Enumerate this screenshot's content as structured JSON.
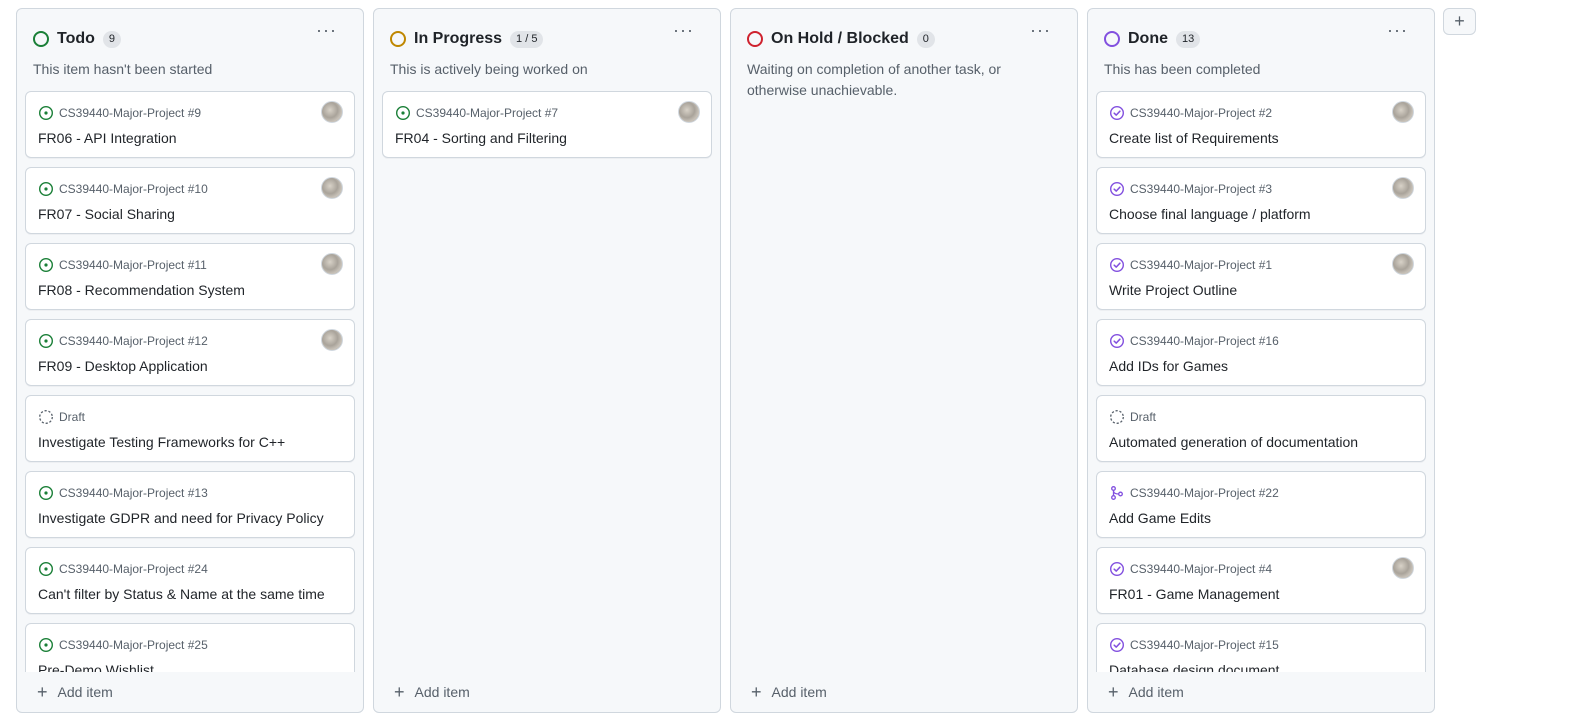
{
  "columns": [
    {
      "title": "Todo",
      "count": "9",
      "color": "#1a7f37",
      "description": "This item hasn't been started",
      "menu": "···",
      "add_label": "Add item",
      "cards": [
        {
          "kind": "open",
          "meta": "CS39440-Major-Project #9",
          "title": "FR06 - API Integration",
          "avatar": true
        },
        {
          "kind": "open",
          "meta": "CS39440-Major-Project #10",
          "title": "FR07 - Social Sharing",
          "avatar": true
        },
        {
          "kind": "open",
          "meta": "CS39440-Major-Project #11",
          "title": "FR08 - Recommendation System",
          "avatar": true
        },
        {
          "kind": "open",
          "meta": "CS39440-Major-Project #12",
          "title": "FR09 - Desktop Application",
          "avatar": true
        },
        {
          "kind": "draft",
          "meta": "Draft",
          "title": "Investigate Testing Frameworks for C++",
          "avatar": false
        },
        {
          "kind": "open",
          "meta": "CS39440-Major-Project #13",
          "title": "Investigate GDPR and need for Privacy Policy",
          "avatar": false
        },
        {
          "kind": "open",
          "meta": "CS39440-Major-Project #24",
          "title": "Can't filter by Status & Name at the same time",
          "avatar": false
        },
        {
          "kind": "open",
          "meta": "CS39440-Major-Project #25",
          "title": "Pre-Demo Wishlist",
          "avatar": false
        }
      ]
    },
    {
      "title": "In Progress",
      "count": "1 / 5",
      "color": "#bf8700",
      "description": "This is actively being worked on",
      "menu": "···",
      "add_label": "Add item",
      "cards": [
        {
          "kind": "open",
          "meta": "CS39440-Major-Project #7",
          "title": "FR04 - Sorting and Filtering",
          "avatar": true
        }
      ]
    },
    {
      "title": "On Hold / Blocked",
      "count": "0",
      "color": "#cf222e",
      "description": "Waiting on completion of another task, or otherwise unachievable.",
      "menu": "···",
      "add_label": "Add item",
      "cards": []
    },
    {
      "title": "Done",
      "count": "13",
      "color": "#8250df",
      "description": "This has been completed",
      "menu": "···",
      "add_label": "Add item",
      "cards": [
        {
          "kind": "done",
          "meta": "CS39440-Major-Project #2",
          "title": "Create list of Requirements",
          "avatar": true
        },
        {
          "kind": "done",
          "meta": "CS39440-Major-Project #3",
          "title": "Choose final language / platform",
          "avatar": true
        },
        {
          "kind": "done",
          "meta": "CS39440-Major-Project #1",
          "title": "Write Project Outline",
          "avatar": true
        },
        {
          "kind": "done",
          "meta": "CS39440-Major-Project #16",
          "title": "Add IDs for Games",
          "avatar": false
        },
        {
          "kind": "draft",
          "meta": "Draft",
          "title": "Automated generation of documentation",
          "avatar": false
        },
        {
          "kind": "merged",
          "meta": "CS39440-Major-Project #22",
          "title": "Add Game Edits",
          "avatar": false
        },
        {
          "kind": "done",
          "meta": "CS39440-Major-Project #4",
          "title": "FR01 - Game Management",
          "avatar": true
        },
        {
          "kind": "done",
          "meta": "CS39440-Major-Project #15",
          "title": "Database design document",
          "avatar": false
        }
      ]
    }
  ],
  "add_column_label": "+",
  "icon_names": {
    "open": "issue-open-icon",
    "done": "issue-closed-icon",
    "draft": "draft-icon",
    "merged": "pull-request-merged-icon"
  }
}
